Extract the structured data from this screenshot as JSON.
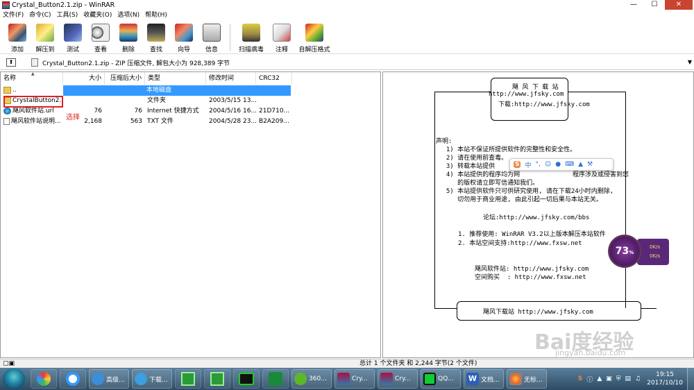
{
  "window": {
    "title": "Crystal_Button2.1.zip - WinRAR",
    "min": "—",
    "max": "☐",
    "close": "✕"
  },
  "menu": [
    "文件(F)",
    "命令(C)",
    "工具(S)",
    "收藏夹(O)",
    "选项(N)",
    "帮助(H)"
  ],
  "toolbar": {
    "add": "添加",
    "extract": "解压到",
    "test": "测试",
    "view": "查看",
    "delete": "删除",
    "find": "查找",
    "wizard": "向导",
    "info": "信息",
    "virus": "扫描病毒",
    "comment": "注释",
    "sfx": "自解压格式"
  },
  "address": {
    "text": "Crystal_Button2.1.zip - ZIP 压缩文件, 解包大小为 928,389 字节"
  },
  "columns": {
    "name": "名称",
    "size": "大小",
    "packed": "压缩后大小",
    "type": "类型",
    "modified": "修改时间",
    "crc": "CRC32"
  },
  "files": [
    {
      "name": "..",
      "size": "",
      "packed": "",
      "type": "本地磁盘",
      "modified": "",
      "crc": ""
    },
    {
      "name": "CrystalButton2...",
      "size": "",
      "packed": "",
      "type": "文件夹",
      "modified": "2003/5/15 13...",
      "crc": ""
    },
    {
      "name": "飓风软件站.url",
      "size": "76",
      "packed": "76",
      "type": "Internet 快捷方式",
      "modified": "2004/5/16 16...",
      "crc": "21D710..."
    },
    {
      "name": "飓风软件站说明...",
      "size": "2,168",
      "packed": "563",
      "type": "TXT 文件",
      "modified": "2004/5/28 23...",
      "crc": "B2A209..."
    }
  ],
  "annotation": "选择",
  "comment": {
    "site": "飓 风 下 载 站",
    "url1": "http://www.jfsky.com",
    "download": "下载:http://www.jfsky.com",
    "decl": "声明:",
    "l1": "  1) 本站不保证所提供软件的完整性和安全性。",
    "l2": "  2) 请在使用前查毒。",
    "l3": "  3) 转载本站提供",
    "l4": "  4) 本站提供的程序均为网              程序涉及或侵害到您",
    "l4b": "     的版权请立即写信通知我们。",
    "l5": "  5) 本站提供软件只可供研究使用, 请在下载24小时内删除,",
    "l5b": "     切勿用于商业用途, 由此引起一切后果与本站无关。",
    "forum": "论坛:http://www.jfsky.com/bbs",
    "r1": "1. 推荐使用: WinRAR V3.2以上版本解压本站软件",
    "r2": "2. 本站空间支持:http://www.fxsw.net",
    "s1": "飓风软件站: http://www.jfsky.com",
    "s2": "空间购买  : http://www.fxsw.net",
    "footer": "飓风下载站 http://www.jfsky.com"
  },
  "status": {
    "text": "总计 1 个文件夹 和 2,244 字节(2 个文件)"
  },
  "taskbar": {
    "items": [
      "高级...",
      "下载...",
      "360...",
      "Cry...",
      "Cry...",
      "QQ...",
      "文档...",
      "无标..."
    ],
    "time": "19:15",
    "date": "2017/10/10"
  },
  "overlay": {
    "score": "73",
    "unit": "%",
    "up": "0K/s",
    "down": "0K/s",
    "ime": "中"
  },
  "watermark": {
    "logo": "Bai度经验",
    "url": "jingyan.baidu.com"
  }
}
